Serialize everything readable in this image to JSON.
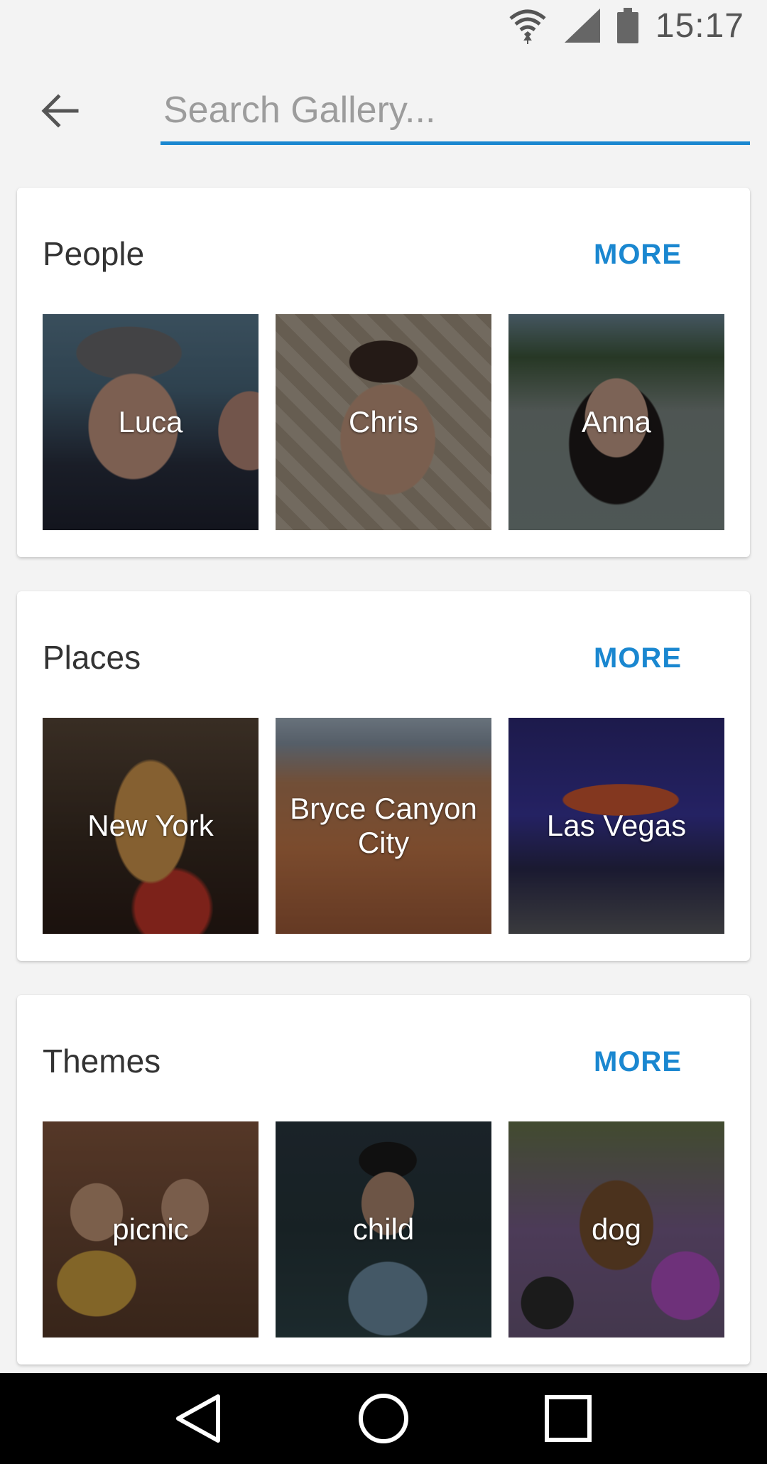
{
  "status_bar": {
    "time": "15:17",
    "icons": [
      "wifi-icon",
      "signal-icon",
      "battery-icon"
    ]
  },
  "search": {
    "placeholder": "Search Gallery...",
    "value": "",
    "back_icon": "arrow-back-icon"
  },
  "sections": [
    {
      "title": "People",
      "more_label": "MORE",
      "items": [
        {
          "label": "Luca"
        },
        {
          "label": "Chris"
        },
        {
          "label": "Anna"
        }
      ]
    },
    {
      "title": "Places",
      "more_label": "MORE",
      "items": [
        {
          "label": "New York"
        },
        {
          "label": "Bryce Canyon City"
        },
        {
          "label": "Las Vegas"
        }
      ]
    },
    {
      "title": "Themes",
      "more_label": "MORE",
      "items": [
        {
          "label": "picnic"
        },
        {
          "label": "child"
        },
        {
          "label": "dog"
        }
      ]
    }
  ],
  "navbar": {
    "icons": [
      "back-triangle-icon",
      "home-circle-icon",
      "recents-square-icon"
    ]
  },
  "colors": {
    "accent": "#1a87d0",
    "background": "#f3f3f3",
    "navbar": "#000000"
  }
}
